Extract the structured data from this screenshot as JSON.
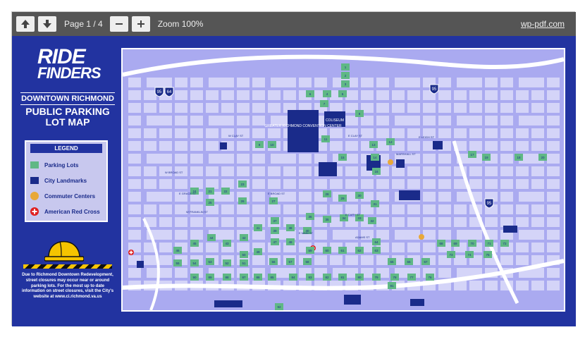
{
  "toolbar": {
    "page_label": "Page 1 / 4",
    "zoom_label": "Zoom 100%",
    "brand": "wp-pdf.com",
    "icons": {
      "prev": "arrow-up-icon",
      "next": "arrow-down-icon",
      "zoom_out": "minus-icon",
      "zoom_in": "plus-icon"
    }
  },
  "document": {
    "logo_line1": "RIDE",
    "logo_line2": "FINDERS",
    "subtitle": "DOWNTOWN RICHMOND",
    "title_line1": "PUBLIC PARKING",
    "title_line2": "LOT MAP",
    "legend": {
      "title": "LEGEND",
      "items": [
        {
          "label": "Parking Lots",
          "color": "#5fb885",
          "icon": "square"
        },
        {
          "label": "City Landmarks",
          "color": "#1a2b8a",
          "icon": "square"
        },
        {
          "label": "Commuter Centers",
          "color": "#e8a838",
          "icon": "circle"
        },
        {
          "label": "American Red Cross",
          "color": "#e02020",
          "icon": "red-cross-icon"
        }
      ]
    },
    "note": "Due to Richmond Downtown Redevelopment, street closures may occur near or around parking lots. For the most up to date information on street closures, visit the City's website at www.ci.richmond.va.us"
  },
  "map": {
    "colors": {
      "block": "#d4d4f8",
      "street": "#ffffff",
      "lot": "#5fb885",
      "landmark": "#1a2b8a",
      "commuter": "#e8a838"
    },
    "landmarks": [
      {
        "label": "GREATER RICHMOND CONVENTION CENTER"
      },
      {
        "label": "COLISEUM"
      },
      {
        "label": "CITY HALL"
      },
      {
        "label": "LIBRARY OF VIRGINIA"
      },
      {
        "label": "GOVERNOR'S MANSION"
      },
      {
        "label": "RICHMOND COLISEUM"
      },
      {
        "label": "JACKSON WARD AREA"
      },
      {
        "label": "MONROE PARK"
      },
      {
        "label": "VCU HOSPITAL"
      },
      {
        "label": "17TH ST FARMERS MARKET"
      },
      {
        "label": "FEDERAL RESERVE BANK"
      },
      {
        "label": "ETHYL CORPORATION"
      },
      {
        "label": "RIVERFRONT PLAZA"
      }
    ],
    "streets": [
      {
        "label": "W CLAY ST"
      },
      {
        "label": "E CLAY ST"
      },
      {
        "label": "E LEIGH ST"
      },
      {
        "label": "W BROAD ST"
      },
      {
        "label": "E BROAD ST"
      },
      {
        "label": "E GRACE ST"
      },
      {
        "label": "W FRANKLIN ST"
      },
      {
        "label": "E MAIN ST"
      },
      {
        "label": "E CARY ST"
      },
      {
        "label": "MARSHALL ST"
      },
      {
        "label": "ADAMS ST"
      }
    ],
    "highways": [
      {
        "label": "95"
      },
      {
        "label": "64"
      },
      {
        "label": "95"
      },
      {
        "label": "95"
      }
    ],
    "lots": [
      {
        "number": "1"
      },
      {
        "number": "2"
      },
      {
        "number": "3"
      },
      {
        "number": "4"
      },
      {
        "number": "5"
      },
      {
        "number": "6"
      },
      {
        "number": "7"
      },
      {
        "number": "8"
      },
      {
        "number": "9"
      },
      {
        "number": "10"
      },
      {
        "number": "11"
      },
      {
        "number": "12"
      },
      {
        "number": "13"
      },
      {
        "number": "14"
      },
      {
        "number": "15"
      },
      {
        "number": "16"
      },
      {
        "number": "17"
      },
      {
        "number": "18"
      },
      {
        "number": "19"
      },
      {
        "number": "20"
      },
      {
        "number": "21"
      },
      {
        "number": "22"
      },
      {
        "number": "23"
      },
      {
        "number": "24"
      },
      {
        "number": "25"
      },
      {
        "number": "26"
      },
      {
        "number": "27"
      },
      {
        "number": "28"
      },
      {
        "number": "29"
      },
      {
        "number": "30"
      },
      {
        "number": "31"
      },
      {
        "number": "32"
      },
      {
        "number": "33"
      },
      {
        "number": "34"
      },
      {
        "number": "35"
      },
      {
        "number": "36"
      },
      {
        "number": "37"
      },
      {
        "number": "38"
      },
      {
        "number": "39"
      },
      {
        "number": "40"
      },
      {
        "number": "41"
      },
      {
        "number": "42"
      },
      {
        "number": "43"
      },
      {
        "number": "44"
      },
      {
        "number": "45"
      },
      {
        "number": "46"
      },
      {
        "number": "47"
      },
      {
        "number": "48"
      },
      {
        "number": "49"
      },
      {
        "number": "50"
      },
      {
        "number": "51"
      },
      {
        "number": "52"
      },
      {
        "number": "53"
      },
      {
        "number": "54"
      },
      {
        "number": "55"
      },
      {
        "number": "56"
      },
      {
        "number": "57"
      },
      {
        "number": "58"
      },
      {
        "number": "59"
      },
      {
        "number": "60"
      },
      {
        "number": "61"
      },
      {
        "number": "62"
      },
      {
        "number": "63"
      },
      {
        "number": "64"
      },
      {
        "number": "65"
      },
      {
        "number": "66"
      },
      {
        "number": "67"
      },
      {
        "number": "68"
      },
      {
        "number": "69"
      },
      {
        "number": "70"
      },
      {
        "number": "71"
      },
      {
        "number": "72"
      },
      {
        "number": "73"
      },
      {
        "number": "74"
      },
      {
        "number": "75"
      },
      {
        "number": "76"
      },
      {
        "number": "77"
      },
      {
        "number": "78"
      },
      {
        "number": "79"
      },
      {
        "number": "80"
      },
      {
        "number": "81"
      },
      {
        "number": "82"
      },
      {
        "number": "83"
      },
      {
        "number": "84"
      },
      {
        "number": "85"
      },
      {
        "number": "86"
      },
      {
        "number": "87"
      },
      {
        "number": "88"
      },
      {
        "number": "89"
      },
      {
        "number": "90"
      },
      {
        "number": "91"
      },
      {
        "number": "92"
      }
    ]
  }
}
